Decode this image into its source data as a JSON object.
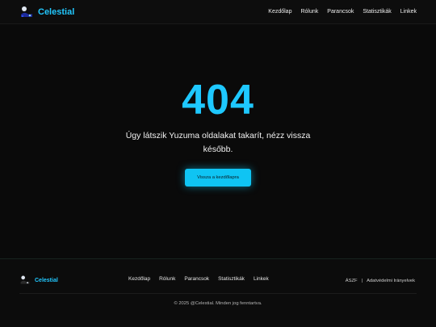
{
  "header": {
    "brand": "Celestial",
    "nav": [
      "Kezdőlap",
      "Rólunk",
      "Parancsok",
      "Statisztikák",
      "Linkek"
    ]
  },
  "main": {
    "code": "404",
    "message": "Úgy látszik Yuzuma oldalakat takarít, nézz vissza később.",
    "back_button": "Vissza a kezdőlapra"
  },
  "footer": {
    "brand": "Celestial",
    "nav": [
      "Kezdőlap",
      "Rólunk",
      "Parancsok",
      "Statisztikák",
      "Linkek"
    ],
    "legal": [
      "ÁSZF",
      "|",
      "Adatvédelmi Irányelvek"
    ],
    "copyright": "© 2025 @Celestial. Minden jog fenntartva."
  },
  "colors": {
    "accent": "#1ec8ff",
    "background": "#0a0a0a"
  },
  "icons": {
    "logo": "celestial-logo-icon"
  }
}
